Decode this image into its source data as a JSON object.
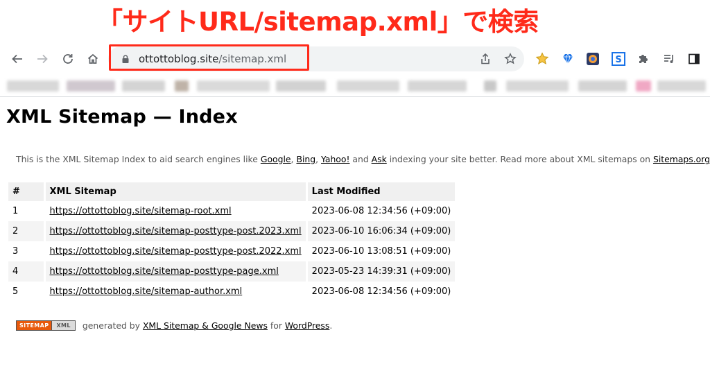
{
  "annotation": {
    "text": "「サイトURL/sitemap.xml」で検索"
  },
  "browser": {
    "url_domain": "ottottoblog.site",
    "url_path": "/sitemap.xml",
    "nav_icons": [
      "back-arrow-icon",
      "forward-arrow-icon",
      "reload-icon",
      "home-icon"
    ],
    "omnibox_icons": [
      "lock-icon",
      "share-icon",
      "bookmark-star-icon"
    ],
    "extension_icons": [
      "star-extension-icon",
      "diamond-extension-icon",
      "colorful-extension-icon",
      "s-extension-icon",
      "puzzle-extensions-icon",
      "media-control-icon",
      "side-panel-icon"
    ]
  },
  "page": {
    "title": "XML Sitemap — Index",
    "intro": {
      "prefix": "This is the XML Sitemap Index to aid search engines like ",
      "link_google": "Google",
      "sep1": ", ",
      "link_bing": "Bing",
      "sep2": ", ",
      "link_yahoo": "Yahoo!",
      "sep3": " and ",
      "link_ask": "Ask",
      "middle": " indexing your site better. Read more about XML sitemaps on ",
      "link_sitemaps": "Sitemaps.org"
    },
    "table": {
      "headers": [
        "#",
        "XML Sitemap",
        "Last Modified"
      ],
      "rows": [
        {
          "num": "1",
          "url": "https://ottottoblog.site/sitemap-root.xml",
          "modified": "2023-06-08 12:34:56 (+09:00)"
        },
        {
          "num": "2",
          "url": "https://ottottoblog.site/sitemap-posttype-post.2023.xml",
          "modified": "2023-06-10 16:06:34 (+09:00)"
        },
        {
          "num": "3",
          "url": "https://ottottoblog.site/sitemap-posttype-post.2022.xml",
          "modified": "2023-06-10 13:08:51 (+09:00)"
        },
        {
          "num": "4",
          "url": "https://ottottoblog.site/sitemap-posttype-page.xml",
          "modified": "2023-05-23 14:39:31 (+09:00)"
        },
        {
          "num": "5",
          "url": "https://ottottoblog.site/sitemap-author.xml",
          "modified": "2023-06-08 12:34:56 (+09:00)"
        }
      ]
    },
    "footer": {
      "badge_left": "SITEMAP",
      "badge_right": "XML",
      "generated_by": " generated by ",
      "link_plugin": "XML Sitemap & Google News",
      "for": " for ",
      "link_wordpress": "WordPress",
      "end": "."
    }
  },
  "colors": {
    "annotation": "#ff2a1a",
    "omnibox_bg": "#f1f3f4",
    "table_header_bg": "#f0f0f0",
    "table_alt_bg": "#f4f4f4",
    "badge_orange": "#e8590c"
  }
}
